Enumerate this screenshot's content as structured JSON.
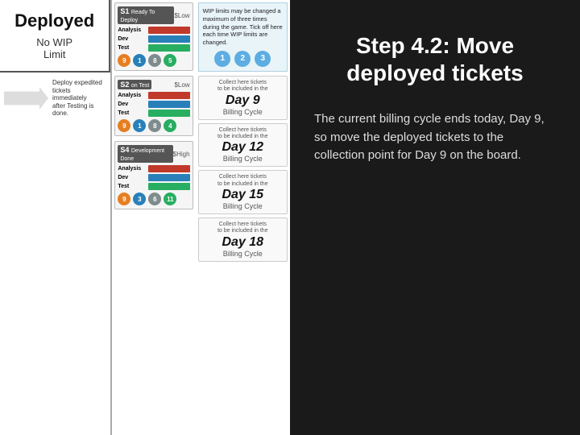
{
  "left": {
    "deployed_title": "Deployed",
    "no_wip": "No WIP\nLimit",
    "arrow_label": "Deploy expedited\ntickets immediately\nafter Testing is done.",
    "wip_note": "WIP limits may be changed a maximum of three times during the game. Tick off here each time WIP limits are changed.",
    "wip_circles": [
      "1",
      "2",
      "3"
    ],
    "billing_cards": [
      {
        "collect": "Collect here tickets\nto be included in the",
        "day": "Day 9",
        "cycle": "Billing Cycle"
      },
      {
        "collect": "Collect here tickets\nto be included in the",
        "day": "Day 12",
        "cycle": "Billing Cycle"
      },
      {
        "collect": "Collect here tickets\nto be included in the",
        "day": "Day 15",
        "cycle": "Billing Cycle"
      },
      {
        "collect": "Collect here tickets\nto be included in the",
        "day": "Day 18",
        "cycle": "Billing Cycle"
      }
    ],
    "tickets": [
      {
        "id": "S1",
        "sub": "Ready To Deploy",
        "priority": "$Low",
        "rows": [
          "Analysis",
          "Dev",
          "Test"
        ],
        "numbers": [
          "9",
          "1",
          "8",
          "5"
        ]
      },
      {
        "id": "S2",
        "sub": "on Test",
        "priority": "$Low",
        "rows": [
          "Analysis",
          "Dev",
          "Test"
        ],
        "numbers": [
          "9",
          "1",
          "8",
          "4"
        ]
      },
      {
        "id": "S4",
        "sub": "Development Done",
        "priority": "$High",
        "rows": [
          "Analysis",
          "Dev",
          "Test"
        ],
        "numbers": [
          "9",
          "3",
          "6",
          "11"
        ]
      }
    ]
  },
  "right": {
    "step_title": "Step 4.2: Move deployed tickets",
    "description": "The current billing cycle ends today, Day 9, so move the deployed tickets to the collection point for Day 9 on the board."
  }
}
